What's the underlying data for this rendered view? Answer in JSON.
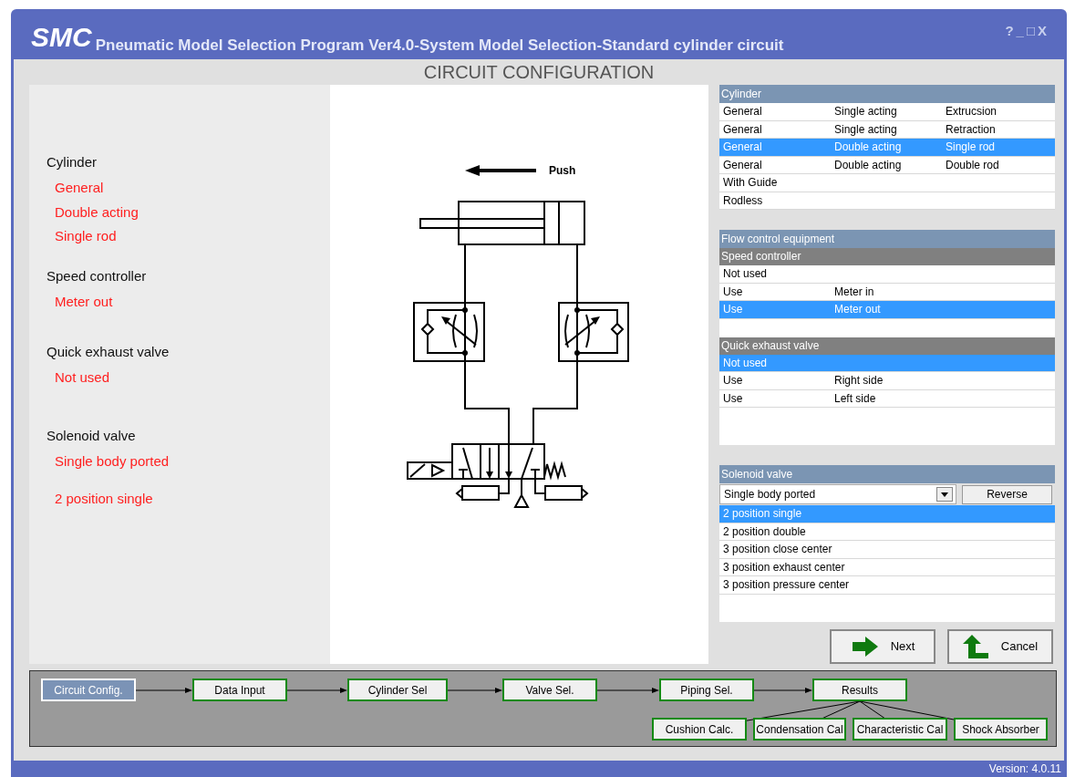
{
  "window": {
    "logo": "SMC",
    "title": "Pneumatic Model Selection Program Ver4.0-System Model Selection-Standard cylinder circuit",
    "controls": [
      "?",
      "_",
      "□",
      "X"
    ]
  },
  "heading": "CIRCUIT CONFIGURATION",
  "summary": [
    {
      "label": "Cylinder",
      "values": [
        "General",
        "Double acting",
        "Single rod"
      ]
    },
    {
      "label": "Speed controller",
      "values": [
        "Meter out"
      ]
    },
    {
      "label": "Quick exhaust valve",
      "values": [
        "Not used"
      ]
    },
    {
      "label": "Solenoid valve",
      "values": [
        "Single body ported",
        "2 position single"
      ]
    }
  ],
  "diagram": {
    "label": "Push"
  },
  "cylinder_list": {
    "header": "Cylinder",
    "rows": [
      {
        "cells": [
          "General",
          "Single acting",
          "Extrucsion"
        ],
        "selected": false
      },
      {
        "cells": [
          "General",
          "Single acting",
          "Retraction"
        ],
        "selected": false
      },
      {
        "cells": [
          "General",
          "Double acting",
          "Single rod"
        ],
        "selected": true
      },
      {
        "cells": [
          "General",
          "Double acting",
          "Double rod"
        ],
        "selected": false
      },
      {
        "cells": [
          "With Guide"
        ],
        "selected": false
      },
      {
        "cells": [
          "Rodless"
        ],
        "selected": false
      }
    ]
  },
  "flow_control": {
    "header": "Flow control equipment",
    "groups": [
      {
        "header": "Speed controller",
        "rows": [
          {
            "cells": [
              "Not used"
            ],
            "selected": false
          },
          {
            "cells": [
              "Use",
              "Meter in"
            ],
            "selected": false
          },
          {
            "cells": [
              "Use",
              "Meter out"
            ],
            "selected": true
          }
        ]
      },
      {
        "header": "Quick exhaust valve",
        "rows": [
          {
            "cells": [
              "Not used"
            ],
            "selected": true
          },
          {
            "cells": [
              "Use",
              "Right side"
            ],
            "selected": false
          },
          {
            "cells": [
              "Use",
              "Left side"
            ],
            "selected": false
          }
        ]
      }
    ]
  },
  "solenoid_valve": {
    "header": "Solenoid valve",
    "dropdown": "Single body ported",
    "reverse_button": "Reverse",
    "rows": [
      {
        "label": "2 position single",
        "selected": true
      },
      {
        "label": "2 position double",
        "selected": false
      },
      {
        "label": "3 position close center",
        "selected": false
      },
      {
        "label": "3 position exhaust center",
        "selected": false
      },
      {
        "label": "3 position pressure center",
        "selected": false
      }
    ]
  },
  "buttons": [
    {
      "label": "Next",
      "kind": "next"
    },
    {
      "label": "Cancel",
      "kind": "cancel"
    }
  ],
  "workflow": {
    "steps": [
      {
        "label": "Circuit Config.",
        "selected": true
      },
      {
        "label": "Data Input",
        "selected": false
      },
      {
        "label": "Cylinder Sel",
        "selected": false
      },
      {
        "label": "Valve Sel.",
        "selected": false
      },
      {
        "label": "Piping Sel.",
        "selected": false
      },
      {
        "label": "Results",
        "selected": false
      }
    ],
    "results": [
      {
        "label": "Cushion Calc.",
        "selected": false
      },
      {
        "label": "Condensation Cal",
        "selected": false
      },
      {
        "label": "Characteristic Cal",
        "selected": false
      },
      {
        "label": "Shock Absorber",
        "selected": false
      }
    ]
  },
  "status_bar": {
    "version": "Version: 4.0.11"
  }
}
